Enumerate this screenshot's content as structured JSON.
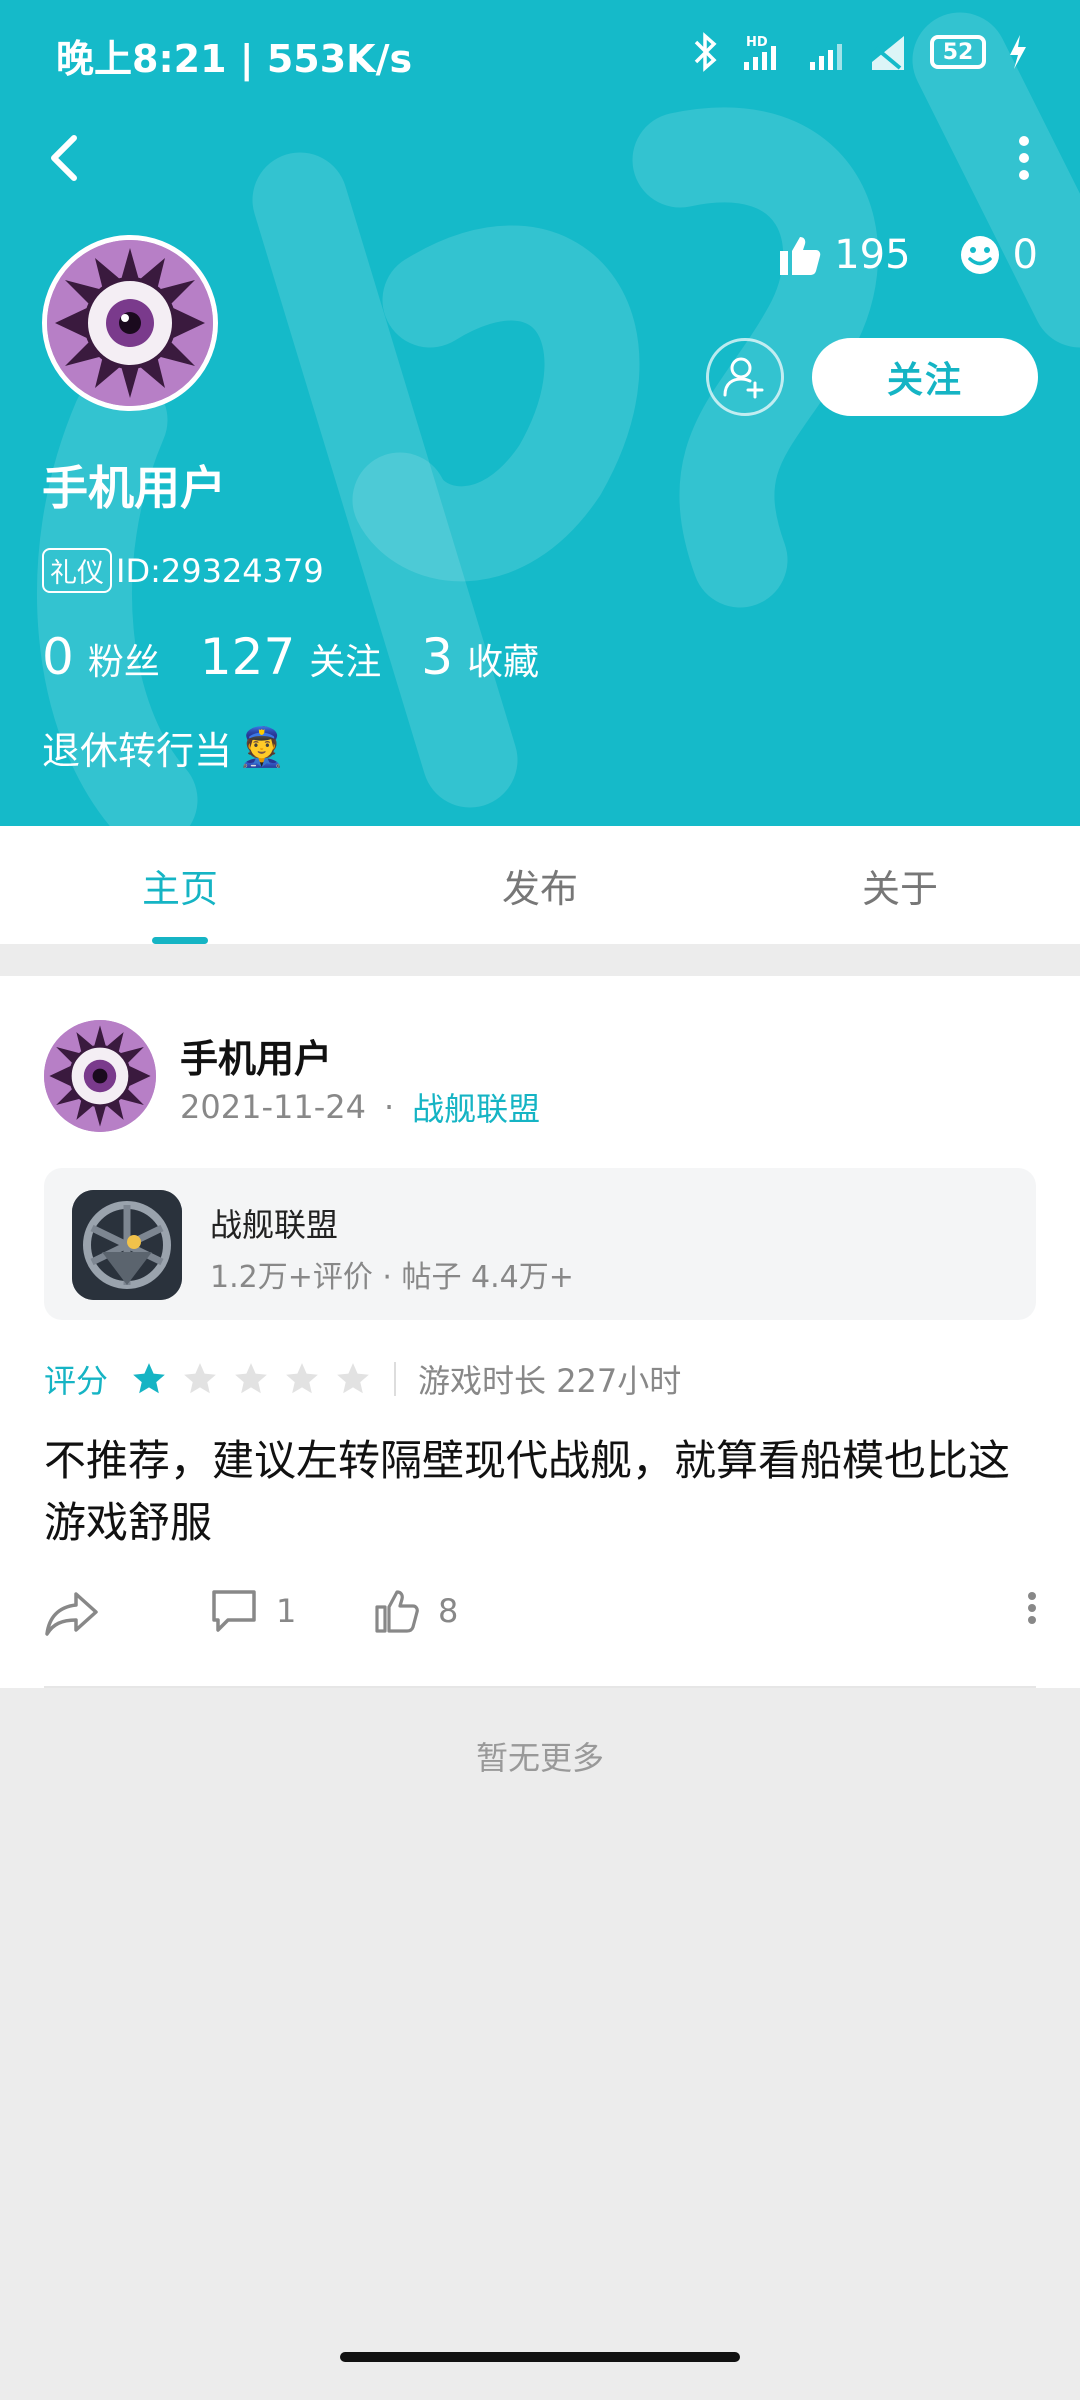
{
  "status_bar": {
    "time": "晚上8:21 | 553K/s",
    "battery": "52"
  },
  "profile": {
    "username": "手机用户",
    "badge": "礼仪",
    "id_text": "ID:29324379",
    "likes": "195",
    "smiles": "0",
    "follow_label": "关注",
    "counts": [
      {
        "num": "0",
        "label": "粉丝"
      },
      {
        "num": "127",
        "label": "关注"
      },
      {
        "num": "3",
        "label": "收藏"
      }
    ],
    "bio": "退休转行当",
    "bio_emoji": "👮"
  },
  "tabs": [
    {
      "label": "主页",
      "active": true
    },
    {
      "label": "发布",
      "active": false
    },
    {
      "label": "关于",
      "active": false
    }
  ],
  "post": {
    "user": "手机用户",
    "date": "2021-11-24",
    "game_tag": "战舰联盟",
    "game": {
      "name": "战舰联盟",
      "stats": "1.2万+评价 · 帖子 4.4万+"
    },
    "rating_label": "评分",
    "rating": 1,
    "rating_max": 5,
    "playtime": "游戏时长 227小时",
    "text": "不推荐，建议左转隔壁现代战舰，就算看船模也比这游戏舒服",
    "comments": "1",
    "likes": "8"
  },
  "footer": {
    "no_more": "暂无更多"
  },
  "colors": {
    "accent": "#15b4c4",
    "header_bg": "#15bac9"
  }
}
